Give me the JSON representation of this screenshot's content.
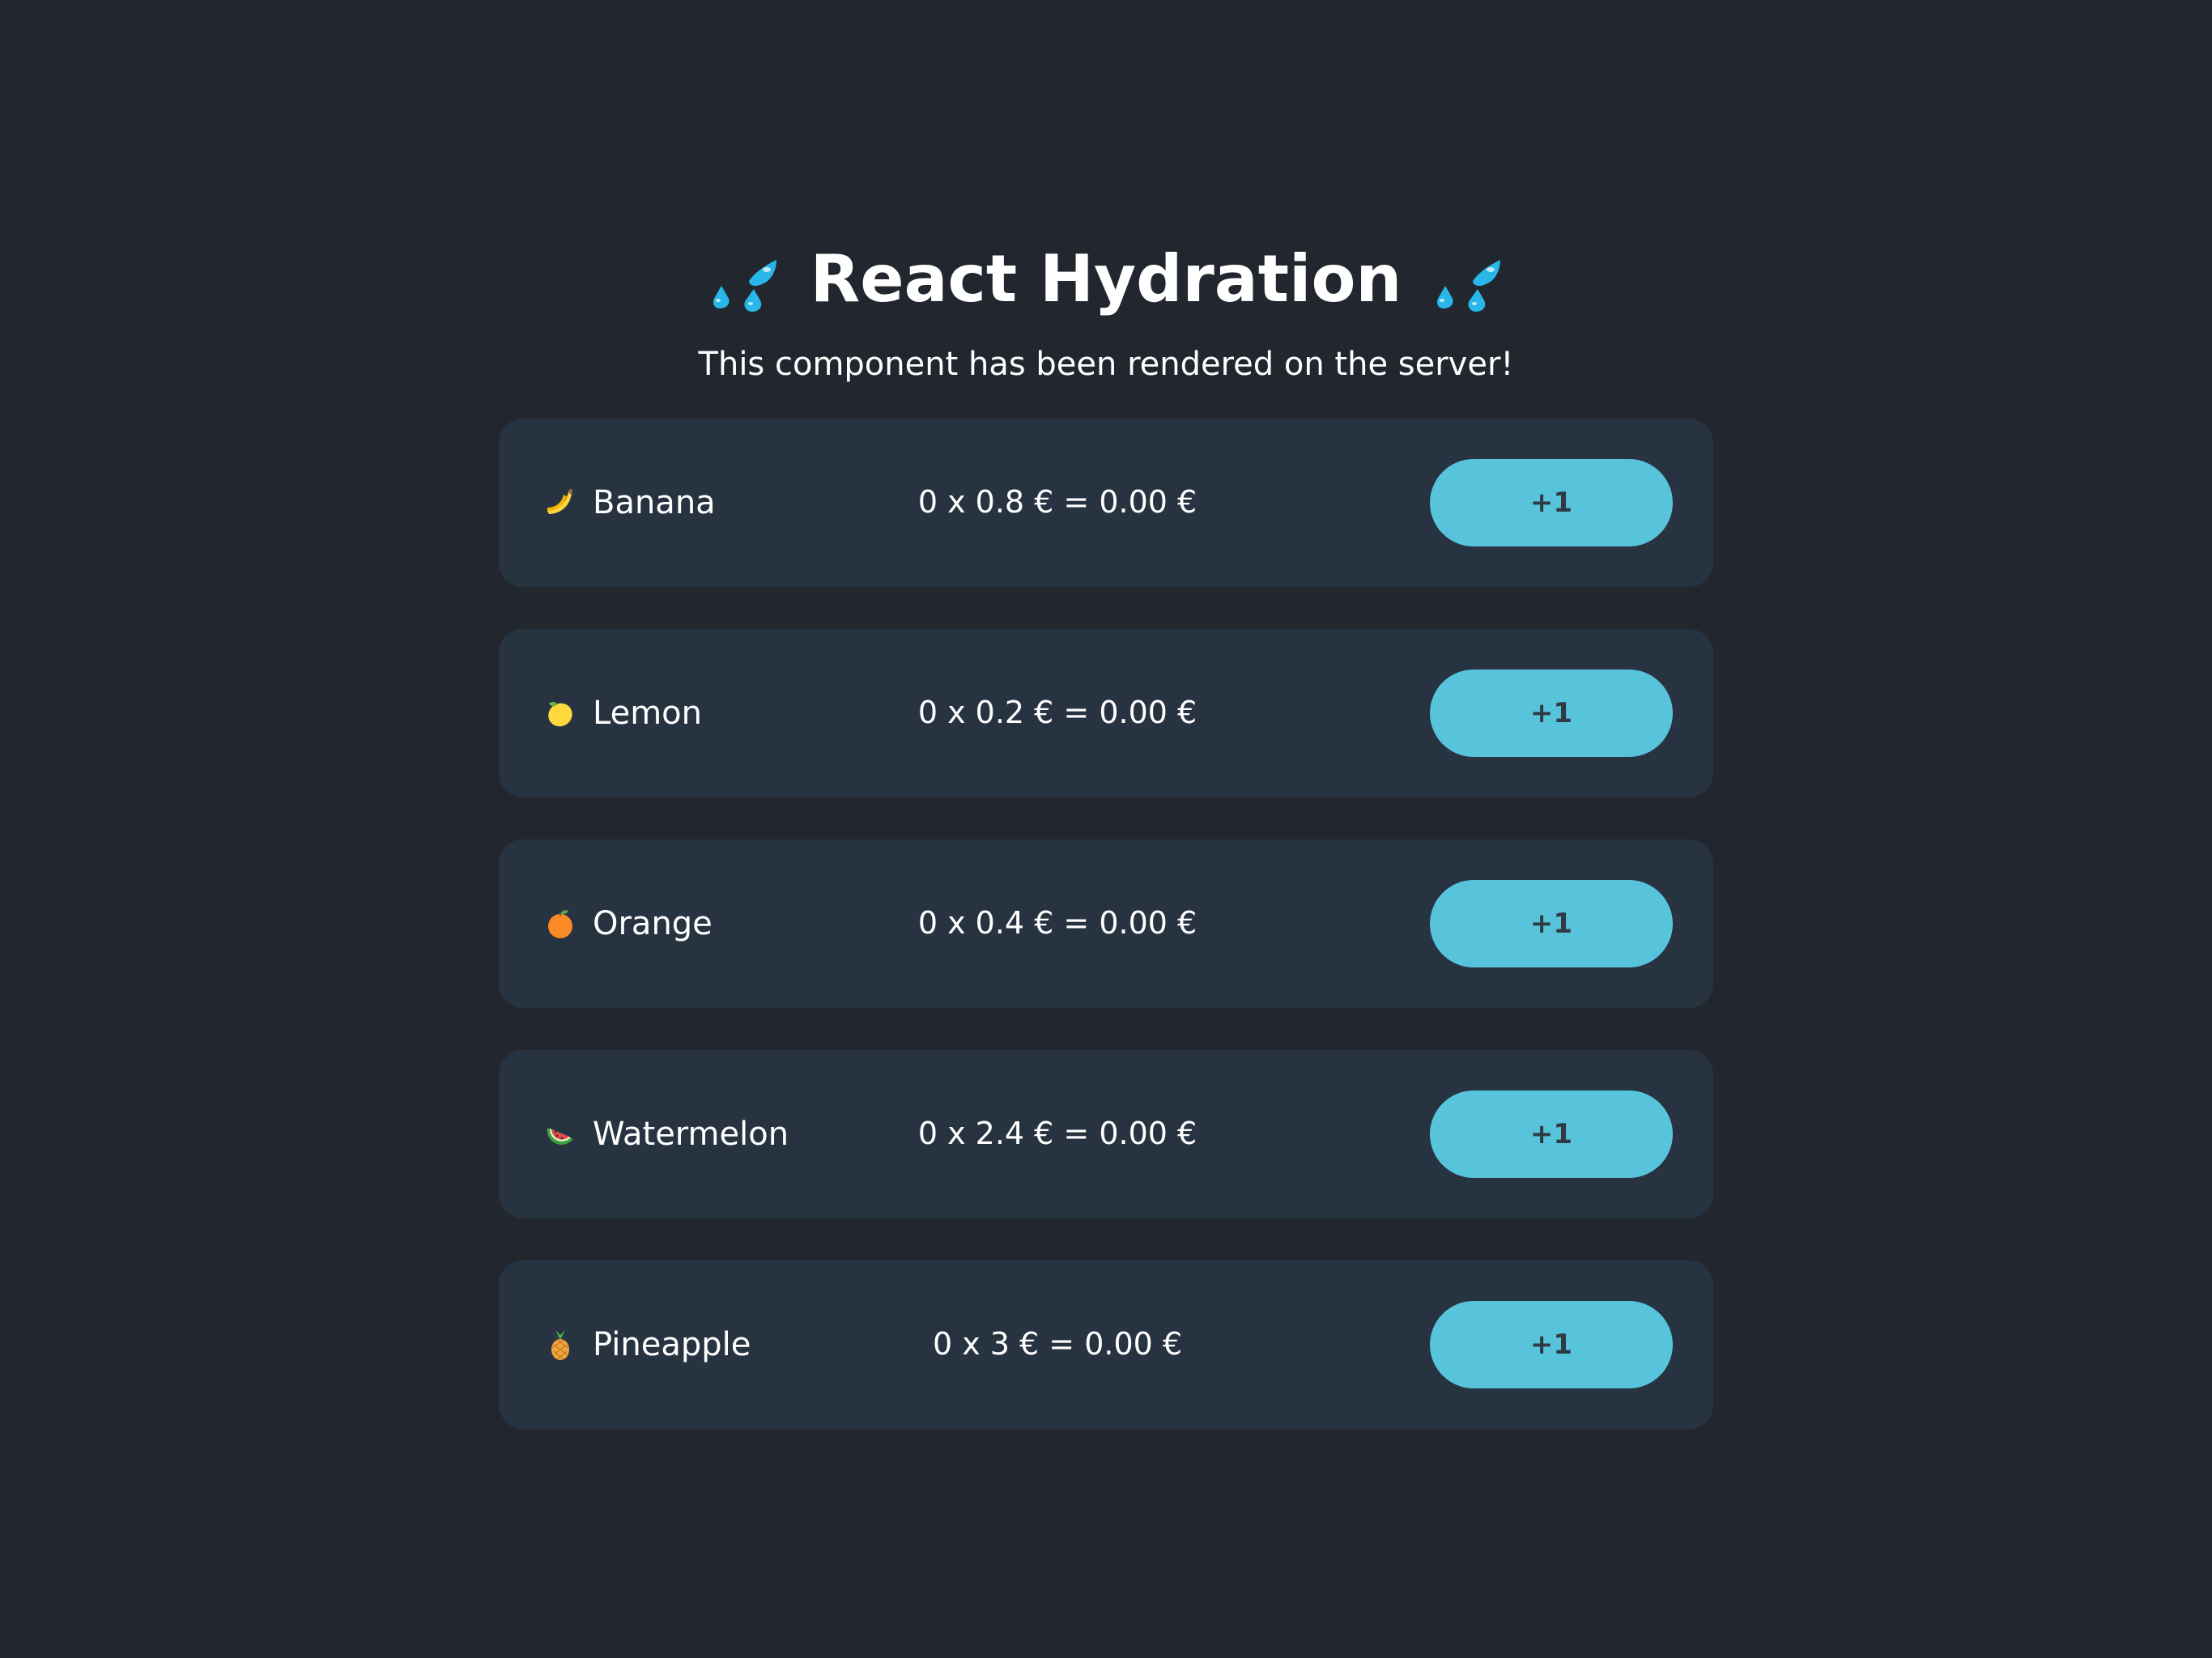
{
  "header": {
    "title": "React Hydration",
    "subtitle": "This component has been rendered on the server!",
    "title_icon": "sweat-droplets-icon"
  },
  "colors": {
    "background": "#22272f",
    "card": "#283341",
    "button": "#57c4db",
    "button_text": "#2f3a44",
    "text": "#ffffff"
  },
  "items": [
    {
      "name": "Banana",
      "icon": "banana-icon",
      "price_line": "0 x 0.8 € = 0.00 €",
      "button_label": "+1"
    },
    {
      "name": "Lemon",
      "icon": "lemon-icon",
      "price_line": "0 x 0.2 € = 0.00 €",
      "button_label": "+1"
    },
    {
      "name": "Orange",
      "icon": "orange-icon",
      "price_line": "0 x 0.4 € = 0.00 €",
      "button_label": "+1"
    },
    {
      "name": "Watermelon",
      "icon": "watermelon-icon",
      "price_line": "0 x 2.4 € = 0.00 €",
      "button_label": "+1"
    },
    {
      "name": "Pineapple",
      "icon": "pineapple-icon",
      "price_line": "0 x 3 € = 0.00 €",
      "button_label": "+1"
    }
  ]
}
